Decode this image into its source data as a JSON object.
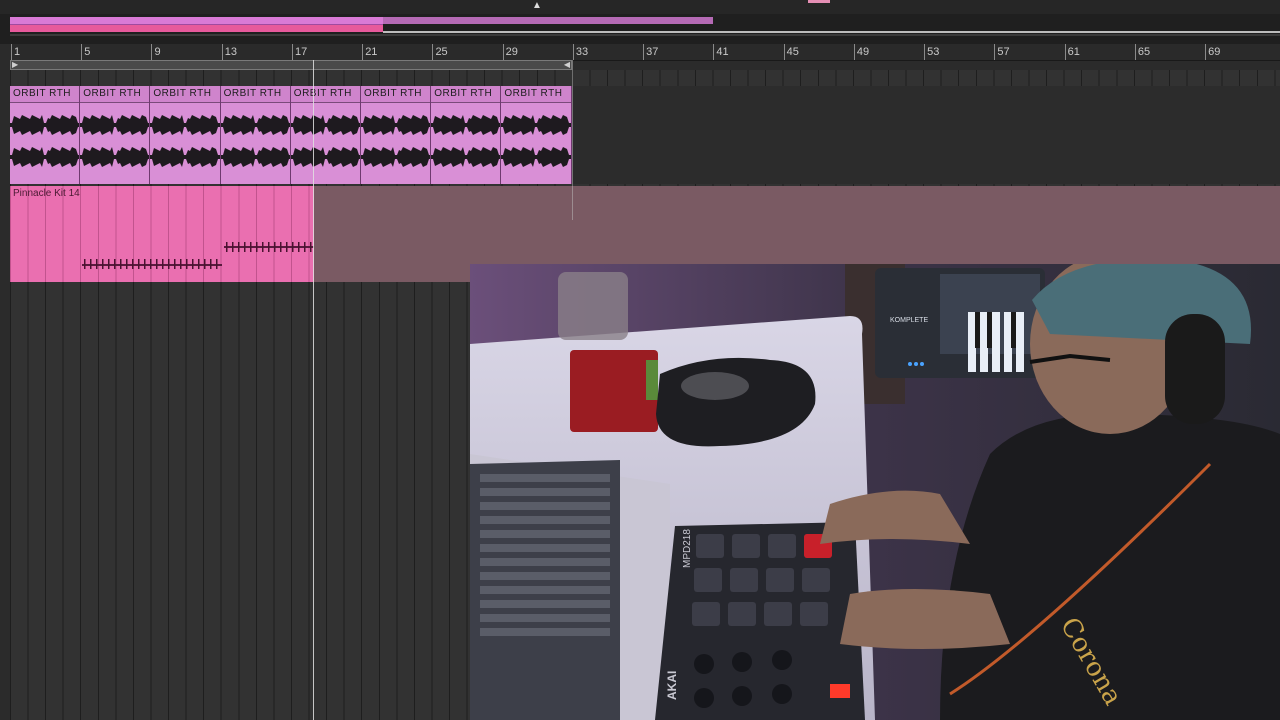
{
  "ruler": {
    "bars": [
      "1",
      "5",
      "9",
      "13",
      "17",
      "21",
      "25",
      "29",
      "33",
      "37",
      "41",
      "45",
      "49",
      "53",
      "57",
      "61",
      "65",
      "69"
    ]
  },
  "tracks": {
    "audio_clips": [
      {
        "name": "ORBIT  RTH"
      },
      {
        "name": "ORBIT  RTH"
      },
      {
        "name": "ORBIT  RTH"
      },
      {
        "name": "ORBIT  RTH"
      },
      {
        "name": "ORBIT  RTH"
      },
      {
        "name": "ORBIT  RTH"
      },
      {
        "name": "ORBIT  RTH"
      },
      {
        "name": "ORBIT  RTH"
      }
    ],
    "midi_clip": {
      "name": "Pinnacle Kit 14"
    }
  },
  "webcam": {
    "device_label": "MPD218",
    "brand_label": "AKAI",
    "keyboard_label": "KOMPLETE",
    "shirt_text": "Corona"
  },
  "colors": {
    "audio_clip": "#d98fd6",
    "midi_clip": "#ea6fb0",
    "midi_lane": "#7a5a63",
    "background": "#2b2b2b"
  }
}
